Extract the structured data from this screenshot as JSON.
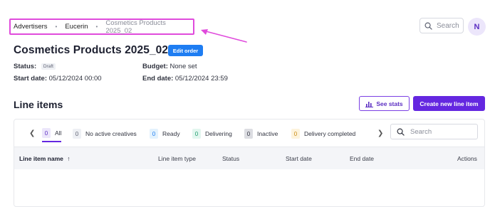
{
  "breadcrumb": {
    "items": [
      "Advertisers",
      "Eucerin",
      "Cosmetics Products 2025_02"
    ],
    "separator": "•"
  },
  "header": {
    "search_placeholder": "Search",
    "avatar_initial": "N"
  },
  "order": {
    "title": "Cosmetics Products 2025_02",
    "edit_label": "Edit order",
    "status_label": "Status:",
    "status_value": "Draft",
    "budget_label": "Budget:",
    "budget_value": "None set",
    "start_label": "Start date:",
    "start_value": "05/12/2024 00:00",
    "end_label": "End date:",
    "end_value": "05/12/2024 23:59"
  },
  "line_items": {
    "title": "Line items",
    "see_stats_label": "See stats",
    "create_label": "Create new line item",
    "filters": [
      {
        "count": "0",
        "label": "All",
        "color": "#ece6fb",
        "text": "#5b2ec2"
      },
      {
        "count": "0",
        "label": "No active creatives",
        "color": "#eef0f4",
        "text": "#5e6272"
      },
      {
        "count": "0",
        "label": "Ready",
        "color": "#e3f2fd",
        "text": "#1e7df2"
      },
      {
        "count": "0",
        "label": "Delivering",
        "color": "#e2f6ef",
        "text": "#1c9c6b"
      },
      {
        "count": "0",
        "label": "Inactive",
        "color": "#dcdde2",
        "text": "#30333f"
      },
      {
        "count": "0",
        "label": "Delivery completed",
        "color": "#fdf3dc",
        "text": "#c98a12"
      }
    ],
    "search_placeholder": "Search",
    "columns": [
      "Line item name",
      "Line item type",
      "Status",
      "Start date",
      "End date",
      "Actions"
    ]
  },
  "colors": {
    "accent": "#6427e0",
    "annotation": "#e04bdc",
    "primary_blue": "#1e7df2"
  }
}
